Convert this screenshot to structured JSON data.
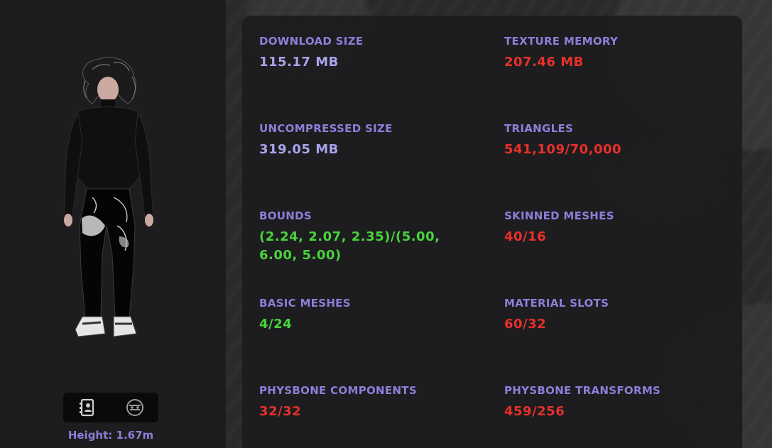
{
  "colors": {
    "label": "#8c7fd9",
    "neutral": "#a9a3ec",
    "bad": "#e8302a",
    "good": "#49d43b"
  },
  "preview": {
    "height_text": "Height: 1.67m",
    "toggle": [
      {
        "icon": "outfit-icon"
      },
      {
        "icon": "face-icon"
      }
    ]
  },
  "stats": {
    "download_size": {
      "label": "DOWNLOAD SIZE",
      "value": "115.17 MB",
      "status": "neutral"
    },
    "texture_memory": {
      "label": "TEXTURE MEMORY",
      "value": "207.46 MB",
      "status": "bad"
    },
    "uncompressed_size": {
      "label": "UNCOMPRESSED SIZE",
      "value": "319.05 MB",
      "status": "neutral"
    },
    "triangles": {
      "label": "TRIANGLES",
      "value": "541,109/70,000",
      "status": "bad"
    },
    "bounds": {
      "label": "BOUNDS",
      "value": "(2.24, 2.07, 2.35)/(5.00, 6.00, 5.00)",
      "status": "good"
    },
    "skinned_meshes": {
      "label": "SKINNED MESHES",
      "value": "40/16",
      "status": "bad"
    },
    "basic_meshes": {
      "label": "BASIC MESHES",
      "value": "4/24",
      "status": "good"
    },
    "material_slots": {
      "label": "MATERIAL SLOTS",
      "value": "60/32",
      "status": "bad"
    },
    "physbone_components": {
      "label": "PHYSBONE COMPONENTS",
      "value": "32/32",
      "status": "bad"
    },
    "physbone_transforms": {
      "label": "PHYSBONE TRANSFORMS",
      "value": "459/256",
      "status": "bad"
    }
  }
}
